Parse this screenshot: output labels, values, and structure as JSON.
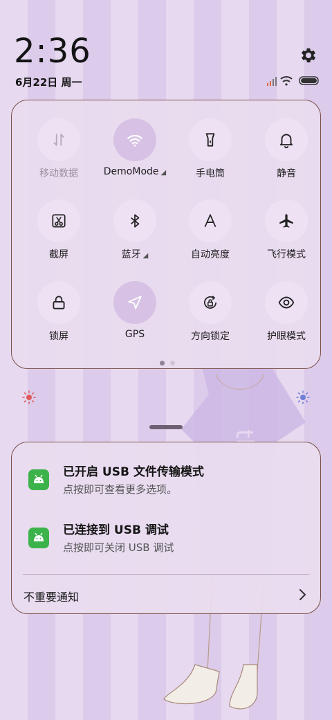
{
  "status": {
    "time": "2:36",
    "date": "6月22日 周一"
  },
  "control_center": {
    "tiles": [
      {
        "label": "移动数据",
        "icon": "mobile-data-icon",
        "state": "disabled"
      },
      {
        "label": "DemoMode",
        "icon": "wifi-icon",
        "state": "active",
        "has_caret": true
      },
      {
        "label": "手电筒",
        "icon": "flashlight-icon",
        "state": "inactive"
      },
      {
        "label": "静音",
        "icon": "bell-icon",
        "state": "inactive"
      },
      {
        "label": "截屏",
        "icon": "screenshot-icon",
        "state": "inactive"
      },
      {
        "label": "蓝牙",
        "icon": "bluetooth-icon",
        "state": "inactive",
        "has_caret": true
      },
      {
        "label": "自动亮度",
        "icon": "auto-brightness-icon",
        "state": "inactive"
      },
      {
        "label": "飞行模式",
        "icon": "airplane-icon",
        "state": "inactive"
      },
      {
        "label": "锁屏",
        "icon": "lock-icon",
        "state": "inactive"
      },
      {
        "label": "GPS",
        "icon": "location-arrow-icon",
        "state": "active"
      },
      {
        "label": "方向锁定",
        "icon": "rotation-lock-icon",
        "state": "inactive"
      },
      {
        "label": "护眼模式",
        "icon": "eye-icon",
        "state": "inactive"
      }
    ],
    "page_count": 2,
    "current_page": 1
  },
  "brightness": {
    "level": 1.0
  },
  "notifications": [
    {
      "title": "已开启 USB 文件传输模式",
      "body": "点按即可查看更多选项。",
      "app_icon": "android-icon"
    },
    {
      "title": "已连接到 USB 调试",
      "body": "点按即可关闭 USB 调试",
      "app_icon": "android-icon"
    }
  ],
  "unimportant_label": "不重要通知",
  "colors": {
    "accent": "#d7c2e5",
    "panel_border": "#7a5148",
    "app_icon": "#3cb34a",
    "brightness_low": "#e05a5a",
    "brightness_high": "#6f7fd6"
  }
}
